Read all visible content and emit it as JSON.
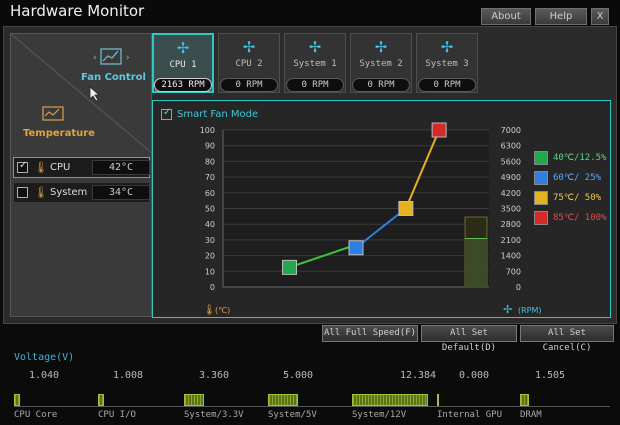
{
  "window": {
    "title": "Hardware Monitor",
    "about_label": "About",
    "help_label": "Help",
    "close_label": "X"
  },
  "left": {
    "fan_control_label": "Fan Control",
    "temperature_label": "Temperature",
    "sensors": [
      {
        "name": "CPU",
        "value": "42°C",
        "checked": true
      },
      {
        "name": "System",
        "value": "34°C",
        "checked": false
      }
    ]
  },
  "fans": [
    {
      "name": "CPU 1",
      "rpm": "2163 RPM"
    },
    {
      "name": "CPU 2",
      "rpm": "0 RPM"
    },
    {
      "name": "System 1",
      "rpm": "0 RPM"
    },
    {
      "name": "System 2",
      "rpm": "0 RPM"
    },
    {
      "name": "System 3",
      "rpm": "0 RPM"
    }
  ],
  "chart": {
    "mode_label": "Smart Fan Mode",
    "temp_unit": "(℃)",
    "rpm_unit": "(RPM)",
    "legend": [
      {
        "text": "40℃/12.5%",
        "color": "#22a84a",
        "text_color": "#5fd37f"
      },
      {
        "text": "60℃/  25%",
        "color": "#2f7fe0",
        "text_color": "#5ea8ff"
      },
      {
        "text": "75℃/  50%",
        "color": "#e6b320",
        "text_color": "#f0c84a"
      },
      {
        "text": "85℃/ 100%",
        "color": "#d42a2a",
        "text_color": "#e14a4a"
      }
    ]
  },
  "chart_data": {
    "type": "line",
    "y_left_ticks": [
      "100",
      "90",
      "80",
      "70",
      "60",
      "50",
      "40",
      "30",
      "20",
      "10",
      "0"
    ],
    "y_right_ticks": [
      "7000",
      "6300",
      "5600",
      "4900",
      "4200",
      "3500",
      "2800",
      "2100",
      "1400",
      "700",
      "0"
    ],
    "ylim": [
      0,
      100
    ],
    "points": [
      {
        "temp": 40,
        "duty": 12.5,
        "color": "#22a84a"
      },
      {
        "temp": 60,
        "duty": 25,
        "color": "#2f7fe0"
      },
      {
        "temp": 75,
        "duty": 50,
        "color": "#e6b320"
      },
      {
        "temp": 85,
        "duty": 100,
        "color": "#d42a2a"
      }
    ],
    "segment_colors": [
      "#3cc23c",
      "#2f7fe0",
      "#e6b320"
    ],
    "current_rpm": 2163,
    "rpm_max": 7000
  },
  "actions": {
    "full_speed": "All Full Speed(F)",
    "set_default": "All Set Default(D)",
    "set_cancel": "All Set Cancel(C)"
  },
  "voltage": {
    "title": "Voltage(V)",
    "items": [
      {
        "label": "CPU Core",
        "value": "1.040",
        "level": 0.08
      },
      {
        "label": "CPU I/O",
        "value": "1.008",
        "level": 0.08
      },
      {
        "label": "System/3.3V",
        "value": "3.360",
        "level": 0.25
      },
      {
        "label": "System/5V",
        "value": "5.000",
        "level": 0.38
      },
      {
        "label": "System/12V",
        "value": "12.384",
        "level": 0.95
      },
      {
        "label": "Internal GPU",
        "value": "0.000",
        "level": 0.0
      },
      {
        "label": "DRAM",
        "value": "1.505",
        "level": 0.11
      }
    ]
  }
}
